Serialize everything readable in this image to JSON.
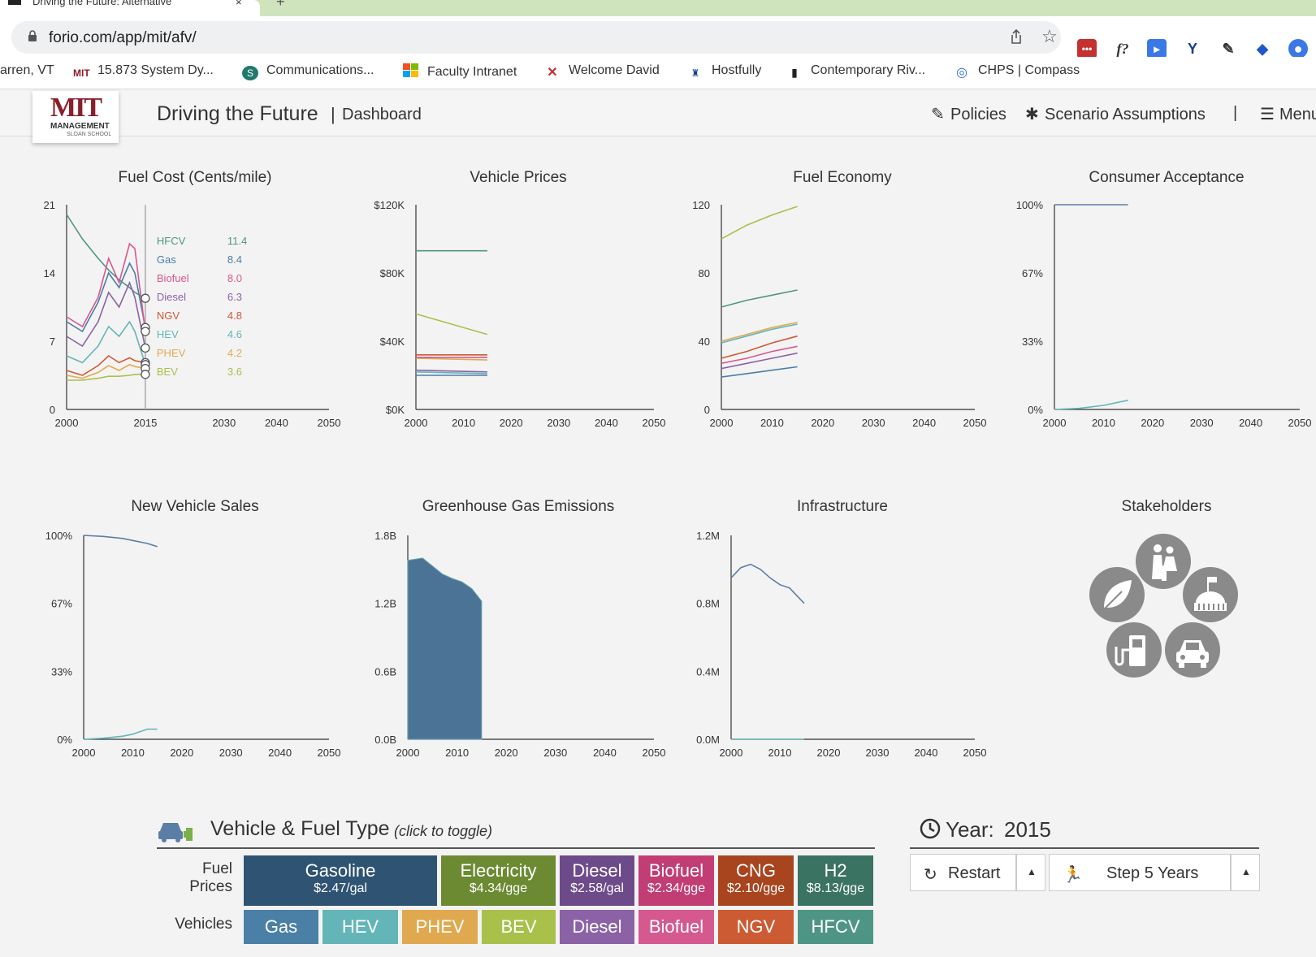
{
  "browser": {
    "tab_title": "Driving the Future: Alternative",
    "tab_close": "×",
    "new_tab": "+",
    "url": "forio.com/app/mit/afv/",
    "bookmarks": [
      {
        "label": "arren, VT",
        "icon": ""
      },
      {
        "label": "15.873 System Dy...",
        "icon": "mit-icon"
      },
      {
        "label": "Communications...",
        "icon": "sharepoint-icon"
      },
      {
        "label": "Faculty Intranet",
        "icon": "windows-icon"
      },
      {
        "label": "Welcome David",
        "icon": "x-icon"
      },
      {
        "label": "Hostfully",
        "icon": "hostfully-icon"
      },
      {
        "label": "Contemporary Riv...",
        "icon": "doc-icon"
      },
      {
        "label": "CHPS | Compass",
        "icon": "compass-icon"
      }
    ],
    "extensions": [
      "lastpass-icon",
      "fx-icon",
      "docs-icon",
      "y-icon",
      "pen-icon",
      "cap-icon",
      "profile-icon"
    ],
    "ext_fx": "f?"
  },
  "app": {
    "logo_mit": "MIT",
    "logo_management": "MANAGEMENT",
    "logo_sloan": "SLOAN SCHOOL",
    "title": "Driving the Future",
    "separator": "|",
    "subtitle": "Dashboard",
    "nav": {
      "policies": "Policies",
      "scenario": "Scenario Assumptions",
      "divider": "|",
      "menu": "Menu"
    }
  },
  "colors": {
    "gas": "#4a7fa6",
    "hev": "#63b5b8",
    "phev": "#e0a94f",
    "bev": "#a9c04b",
    "diesel": "#8b62a6",
    "biofuel": "#d5598f",
    "ngv": "#cc5a33",
    "hfcv": "#4f9585",
    "gasoline_tile": "#2f5373",
    "electricity_tile": "#6b8a32",
    "diesel_tile": "#6d4a8a",
    "biofuel_tile": "#c23d73",
    "cng_tile": "#a8451f",
    "h2_tile": "#3b7363"
  },
  "charts": {
    "fuel_cost": {
      "title": "Fuel Cost (Cents/mile)",
      "type": "line",
      "x_ticks": [
        "2000",
        "2015",
        "2030",
        "2040",
        "2050"
      ],
      "y_ticks": [
        "21",
        "14",
        "7",
        "0"
      ],
      "ylim": [
        0,
        21
      ],
      "xlim": [
        2000,
        2050
      ],
      "hover_year": 2015,
      "legend": [
        {
          "name": "HFCV",
          "value": "11.4"
        },
        {
          "name": "Gas",
          "value": "8.4"
        },
        {
          "name": "Biofuel",
          "value": "8.0"
        },
        {
          "name": "Diesel",
          "value": "6.3"
        },
        {
          "name": "NGV",
          "value": "4.8"
        },
        {
          "name": "HEV",
          "value": "4.6"
        },
        {
          "name": "PHEV",
          "value": "4.2"
        },
        {
          "name": "BEV",
          "value": "3.6"
        }
      ]
    },
    "vehicle_prices": {
      "title": "Vehicle Prices",
      "x_ticks": [
        "2000",
        "2010",
        "2020",
        "2030",
        "2040",
        "2050"
      ],
      "y_ticks": [
        "$120K",
        "$80K",
        "$40K",
        "$0K"
      ]
    },
    "fuel_economy": {
      "title": "Fuel Economy",
      "x_ticks": [
        "2000",
        "2010",
        "2020",
        "2030",
        "2040",
        "2050"
      ],
      "y_ticks": [
        "120",
        "80",
        "40",
        "0"
      ]
    },
    "consumer_acceptance": {
      "title": "Consumer Acceptance",
      "x_ticks": [
        "2000",
        "2010",
        "2020",
        "2030",
        "2040",
        "2050"
      ],
      "y_ticks": [
        "100%",
        "67%",
        "33%",
        "0%"
      ]
    },
    "new_vehicle_sales": {
      "title": "New Vehicle Sales",
      "x_ticks": [
        "2000",
        "2010",
        "2020",
        "2030",
        "2040",
        "2050"
      ],
      "y_ticks": [
        "100%",
        "67%",
        "33%",
        "0%"
      ]
    },
    "ghg": {
      "title": "Greenhouse Gas Emissions",
      "x_ticks": [
        "2000",
        "2010",
        "2020",
        "2030",
        "2040",
        "2050"
      ],
      "y_ticks": [
        "1.8B",
        "1.2B",
        "0.6B",
        "0.0B"
      ]
    },
    "infrastructure": {
      "title": "Infrastructure",
      "x_ticks": [
        "2000",
        "2010",
        "2020",
        "2030",
        "2040",
        "2050"
      ],
      "y_ticks": [
        "1.2M",
        "0.8M",
        "0.4M",
        "0.0M"
      ]
    },
    "stakeholders": {
      "title": "Stakeholders"
    }
  },
  "chart_data": [
    {
      "type": "line",
      "title": "Fuel Cost (Cents/mile)",
      "xlim": [
        2000,
        2050
      ],
      "ylim": [
        0,
        21
      ],
      "x": [
        2000,
        2003,
        2006,
        2008,
        2010,
        2012,
        2013,
        2015
      ],
      "series": [
        {
          "name": "HFCV",
          "values": [
            20.0,
            17.5,
            15.5,
            14.3,
            13.3,
            12.5,
            12.0,
            11.4
          ]
        },
        {
          "name": "Gas",
          "values": [
            9.0,
            8.0,
            11.0,
            14.0,
            12.5,
            15.0,
            14.0,
            8.4
          ]
        },
        {
          "name": "Biofuel",
          "values": [
            9.5,
            8.5,
            11.5,
            15.5,
            13.0,
            17.0,
            16.5,
            8.0
          ]
        },
        {
          "name": "Diesel",
          "values": [
            7.5,
            6.5,
            9.0,
            12.0,
            10.5,
            13.0,
            11.5,
            6.3
          ]
        },
        {
          "name": "NGV",
          "values": [
            4.0,
            3.5,
            4.5,
            5.5,
            4.8,
            5.3,
            5.0,
            4.8
          ]
        },
        {
          "name": "HEV",
          "values": [
            5.5,
            4.8,
            6.5,
            8.5,
            7.5,
            9.0,
            8.0,
            4.6
          ]
        },
        {
          "name": "PHEV",
          "values": [
            3.5,
            3.2,
            3.8,
            4.5,
            4.0,
            4.6,
            4.4,
            4.2
          ]
        },
        {
          "name": "BEV",
          "values": [
            3.0,
            3.0,
            3.2,
            3.4,
            3.4,
            3.5,
            3.6,
            3.6
          ]
        }
      ]
    },
    {
      "type": "line",
      "title": "Vehicle Prices",
      "xlim": [
        2000,
        2050
      ],
      "ylim": [
        0,
        120000
      ],
      "x": [
        2000,
        2015
      ],
      "series": [
        {
          "name": "HFCV",
          "values": [
            93000,
            93000
          ]
        },
        {
          "name": "BEV",
          "values": [
            56000,
            44000
          ]
        },
        {
          "name": "NGV",
          "values": [
            32000,
            32000
          ]
        },
        {
          "name": "PHEV",
          "values": [
            30000,
            29000
          ]
        },
        {
          "name": "Biofuel",
          "values": [
            30500,
            30500
          ]
        },
        {
          "name": "Diesel",
          "values": [
            23000,
            22000
          ]
        },
        {
          "name": "HEV",
          "values": [
            22000,
            21000
          ]
        },
        {
          "name": "Gas",
          "values": [
            20000,
            20000
          ]
        }
      ]
    },
    {
      "type": "line",
      "title": "Fuel Economy",
      "xlim": [
        2000,
        2050
      ],
      "ylim": [
        0,
        120
      ],
      "x": [
        2000,
        2005,
        2010,
        2015
      ],
      "series": [
        {
          "name": "BEV",
          "values": [
            100,
            108,
            114,
            119
          ]
        },
        {
          "name": "HFCV",
          "values": [
            60,
            64,
            67,
            70
          ]
        },
        {
          "name": "PHEV",
          "values": [
            40,
            44,
            48,
            51
          ]
        },
        {
          "name": "HEV",
          "values": [
            39,
            43,
            47,
            50
          ]
        },
        {
          "name": "NGV",
          "values": [
            30,
            34,
            39,
            43
          ]
        },
        {
          "name": "Biofuel",
          "values": [
            27,
            30,
            34,
            37
          ]
        },
        {
          "name": "Diesel",
          "values": [
            24,
            27,
            30,
            33
          ]
        },
        {
          "name": "Gas",
          "values": [
            19,
            21,
            23,
            25
          ]
        }
      ]
    },
    {
      "type": "line",
      "title": "Consumer Acceptance",
      "xlim": [
        2000,
        2050
      ],
      "ylim": [
        0,
        100
      ],
      "x": [
        2000,
        2005,
        2010,
        2015
      ],
      "series": [
        {
          "name": "Gas",
          "values": [
            100,
            100,
            100,
            100
          ]
        },
        {
          "name": "HEV",
          "values": [
            0,
            0.5,
            2,
            4.5
          ]
        }
      ]
    },
    {
      "type": "line",
      "title": "New Vehicle Sales",
      "xlim": [
        2000,
        2050
      ],
      "ylim": [
        0,
        100
      ],
      "x": [
        2000,
        2004,
        2008,
        2010,
        2013,
        2015
      ],
      "series": [
        {
          "name": "Gas",
          "values": [
            100,
            99.5,
            98.5,
            97.5,
            96,
            94.5
          ]
        },
        {
          "name": "HEV",
          "values": [
            0,
            0.5,
            1.5,
            2.5,
            5,
            5
          ]
        }
      ]
    },
    {
      "type": "area",
      "title": "Greenhouse Gas Emissions",
      "xlim": [
        2000,
        2050
      ],
      "ylim": [
        0,
        1.8
      ],
      "x": [
        2000,
        2003,
        2005,
        2007,
        2009,
        2011,
        2013,
        2015
      ],
      "series": [
        {
          "name": "Gas",
          "values": [
            1.58,
            1.6,
            1.53,
            1.46,
            1.42,
            1.39,
            1.33,
            1.22
          ]
        }
      ]
    },
    {
      "type": "line",
      "title": "Infrastructure",
      "xlim": [
        2000,
        2050
      ],
      "ylim": [
        0,
        1.2
      ],
      "x": [
        2000,
        2002,
        2004,
        2006,
        2008,
        2010,
        2012,
        2015
      ],
      "series": [
        {
          "name": "Gas",
          "values": [
            0.95,
            1.01,
            1.03,
            1.0,
            0.95,
            0.91,
            0.89,
            0.8
          ]
        },
        {
          "name": "Alt",
          "values": [
            0,
            0,
            0,
            0,
            0,
            0,
            0,
            0
          ]
        }
      ]
    }
  ],
  "vehicle_fuel": {
    "title": "Vehicle & Fuel Type",
    "toggle_hint": "(click to toggle)",
    "fuel_prices_label": "Fuel Prices",
    "vehicles_label": "Vehicles",
    "fuels": [
      {
        "name": "Gasoline",
        "price": "$2.47/gal"
      },
      {
        "name": "Electricity",
        "price": "$4.34/gge"
      },
      {
        "name": "Diesel",
        "price": "$2.58/gal"
      },
      {
        "name": "Biofuel",
        "price": "$2.34/gge"
      },
      {
        "name": "CNG",
        "price": "$2.10/gge"
      },
      {
        "name": "H2",
        "price": "$8.13/gge"
      }
    ],
    "vehicles": [
      "Gas",
      "HEV",
      "PHEV",
      "BEV",
      "Diesel",
      "Biofuel",
      "NGV",
      "HFCV"
    ]
  },
  "year_panel": {
    "label": "Year:",
    "value": "2015",
    "restart": "Restart",
    "step": "Step 5 Years"
  }
}
